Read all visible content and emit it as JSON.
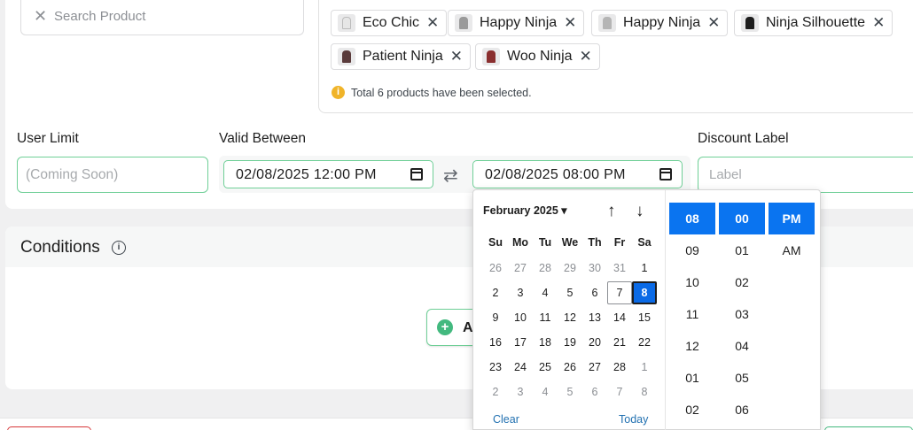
{
  "search": {
    "placeholder": "Search Product"
  },
  "products": [
    {
      "label": "Eco Chic",
      "thumb_color": "#e6e6e6"
    },
    {
      "label": "Happy Ninja",
      "thumb_color": "#9a9a9a"
    },
    {
      "label": "Happy Ninja",
      "thumb_color": "#b5b5b5"
    },
    {
      "label": "Ninja Silhouette",
      "thumb_color": "#1e1e1e"
    },
    {
      "label": "Patient Ninja",
      "thumb_color": "#5a3b3b"
    },
    {
      "label": "Woo Ninja",
      "thumb_color": "#8a2f2f"
    }
  ],
  "selection_note": "Total 6 products have been selected.",
  "user_limit": {
    "label": "User Limit",
    "placeholder": "(Coming Soon)"
  },
  "valid_between": {
    "label": "Valid Between",
    "start": "02/08/2025 12:00 PM",
    "end": "02/08/2025 08:00 PM"
  },
  "discount_label": {
    "label": "Discount Label",
    "placeholder": "Label"
  },
  "conditions": {
    "title": "Conditions",
    "add_label": "A"
  },
  "picker": {
    "month": "February 2025",
    "weekdays": [
      "Su",
      "Mo",
      "Tu",
      "We",
      "Th",
      "Fr",
      "Sa"
    ],
    "weeks": [
      [
        "26",
        "27",
        "28",
        "29",
        "30",
        "31",
        "1"
      ],
      [
        "2",
        "3",
        "4",
        "5",
        "6",
        "7",
        "8"
      ],
      [
        "9",
        "10",
        "11",
        "12",
        "13",
        "14",
        "15"
      ],
      [
        "16",
        "17",
        "18",
        "19",
        "20",
        "21",
        "22"
      ],
      [
        "23",
        "24",
        "25",
        "26",
        "27",
        "28",
        "1"
      ],
      [
        "2",
        "3",
        "4",
        "5",
        "6",
        "7",
        "8"
      ]
    ],
    "today_day": "7",
    "selected_day": "8",
    "clear_label": "Clear",
    "today_label": "Today",
    "hours": [
      "08",
      "09",
      "10",
      "11",
      "12",
      "01",
      "02"
    ],
    "minutes": [
      "00",
      "01",
      "02",
      "03",
      "04",
      "05",
      "06"
    ],
    "meridiem": [
      "PM",
      "AM"
    ]
  },
  "colors": {
    "accent": "#0a74f0",
    "field_border": "#6fcf97",
    "brand_green": "#43b97f"
  }
}
